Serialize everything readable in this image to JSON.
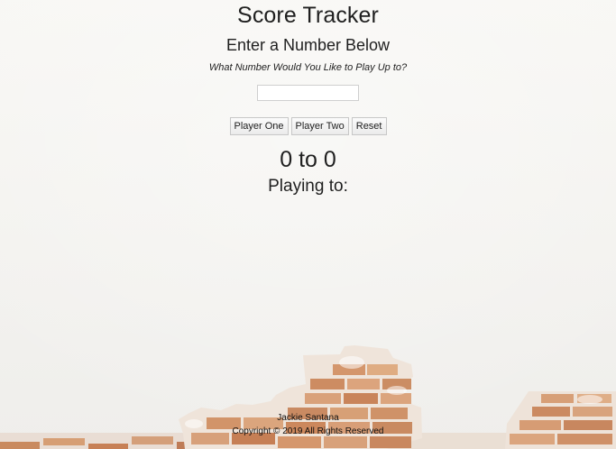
{
  "header": {
    "title": "Score Tracker",
    "subtitle": "Enter a Number Below",
    "prompt": "What Number Would You Like to Play Up to?"
  },
  "form": {
    "number_input_value": "",
    "number_input_placeholder": ""
  },
  "controls": {
    "player_one_label": "Player One",
    "player_two_label": "Player Two",
    "reset_label": "Reset"
  },
  "scoreboard": {
    "player_one_score": "0",
    "separator": "to",
    "player_two_score": "0",
    "playing_to_label": "Playing to:",
    "playing_to_value": ""
  },
  "footer": {
    "author": "Jackie Santana",
    "copyright": "Copyright © 2019 All Rights Reserved"
  },
  "colors": {
    "background": "#f4f3f0",
    "brick": "#d99a6c",
    "mortar": "#eadfd6",
    "text": "#1f1f1f"
  }
}
